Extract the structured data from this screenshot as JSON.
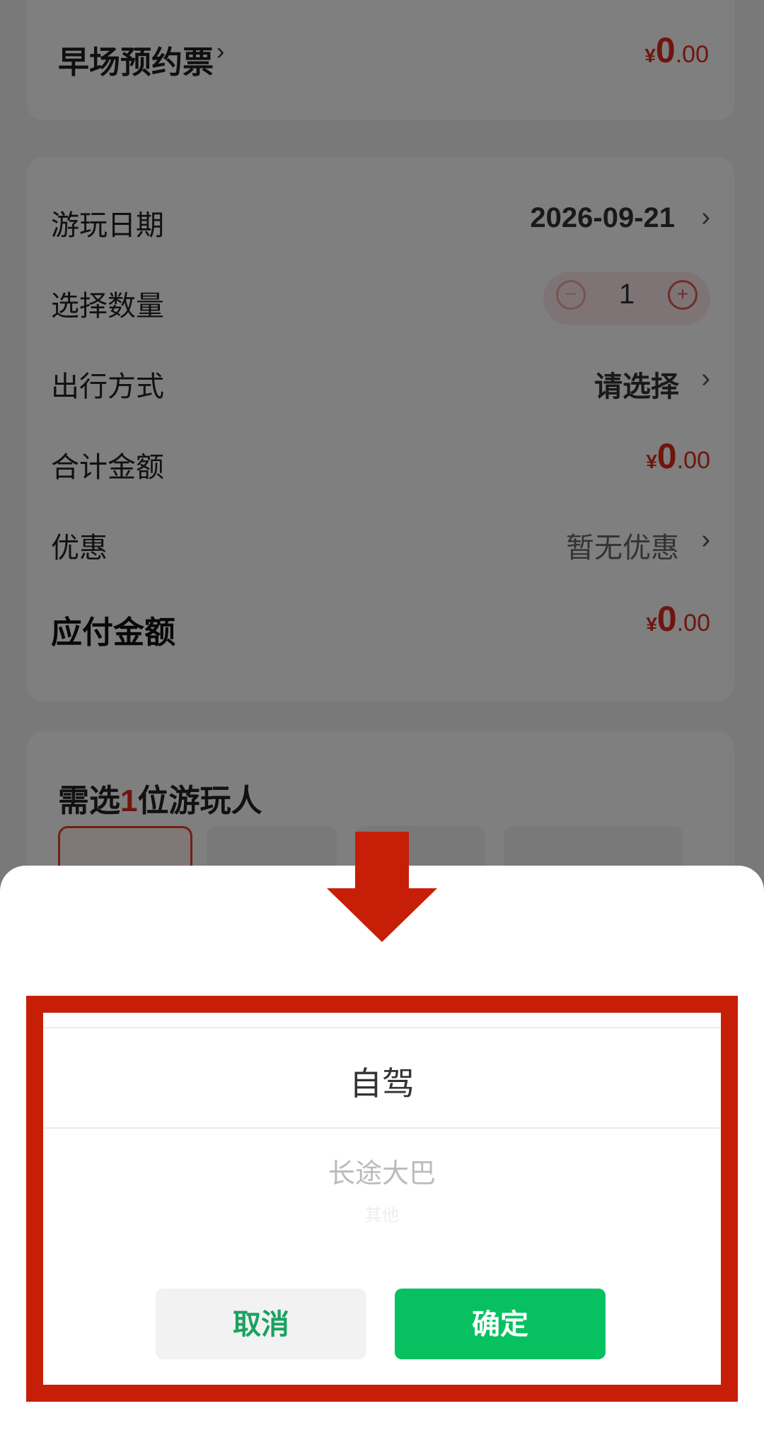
{
  "ticket": {
    "title": "早场预约票",
    "price_symbol": "¥",
    "price_int": "0",
    "price_dec": ".00"
  },
  "order": {
    "date_label": "游玩日期",
    "date_value": "2026-09-21",
    "qty_label": "选择数量",
    "qty_value": "1",
    "travel_label": "出行方式",
    "travel_value": "请选择",
    "total_label": "合计金额",
    "total_symbol": "¥",
    "total_int": "0",
    "total_dec": ".00",
    "discount_label": "优惠",
    "discount_value": "暂无优惠",
    "payable_label": "应付金额",
    "payable_symbol": "¥",
    "payable_int": "0",
    "payable_dec": ".00"
  },
  "traveler": {
    "title_prefix": "需选",
    "title_count": "1",
    "title_suffix": "位游玩人"
  },
  "picker": {
    "selected_option": "自驾",
    "option_2": "长途大巴",
    "option_3": "其他",
    "cancel_label": "取消",
    "confirm_label": "确定"
  },
  "colors": {
    "accent_red": "#e02a1d",
    "frame_red": "#c71e08",
    "confirm_green": "#07c160"
  }
}
